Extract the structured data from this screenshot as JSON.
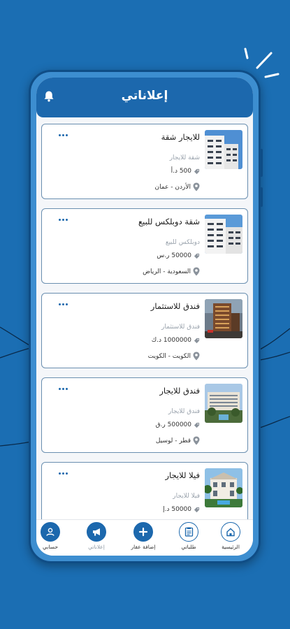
{
  "header": {
    "title": "إعلاناتي"
  },
  "listings": [
    {
      "title": "للايجار شقة",
      "subtitle": "شقة للايجار",
      "price": "500 د.أ",
      "location": "الأردن - عمان",
      "image": "building-white-photo"
    },
    {
      "title": "شقة دوبلكس للبيع",
      "subtitle": "دوبلكس للبيع",
      "price": "50000 ر.س",
      "location": "السعودية - الرياض",
      "image": "building-white-photo"
    },
    {
      "title": "فندق للاستثمار",
      "subtitle": "فندق للاستثمار",
      "price": "1000000 د.ك",
      "location": "الكويت - الكويت",
      "image": "hotel-tower-photo"
    },
    {
      "title": "فندق للايجار",
      "subtitle": "فندق للايجار",
      "price": "500000 ر.ق",
      "location": "قطر - لوسيل",
      "image": "resort-hotel-photo"
    },
    {
      "title": "فيلا للايجار",
      "subtitle": "فيلا للايجار",
      "price": "50000 د.إ",
      "location": "",
      "image": "villa-photo"
    }
  ],
  "nav": {
    "home": "الرئيسية",
    "my_requests": "طلباتي",
    "add_property": "إضافة عقار",
    "my_ads": "إعلاناتي",
    "account": "حسابي"
  },
  "colors": {
    "brand_blue": "#1c68ad",
    "background": "#1b6eb3",
    "card_border": "#6a8fb0"
  }
}
